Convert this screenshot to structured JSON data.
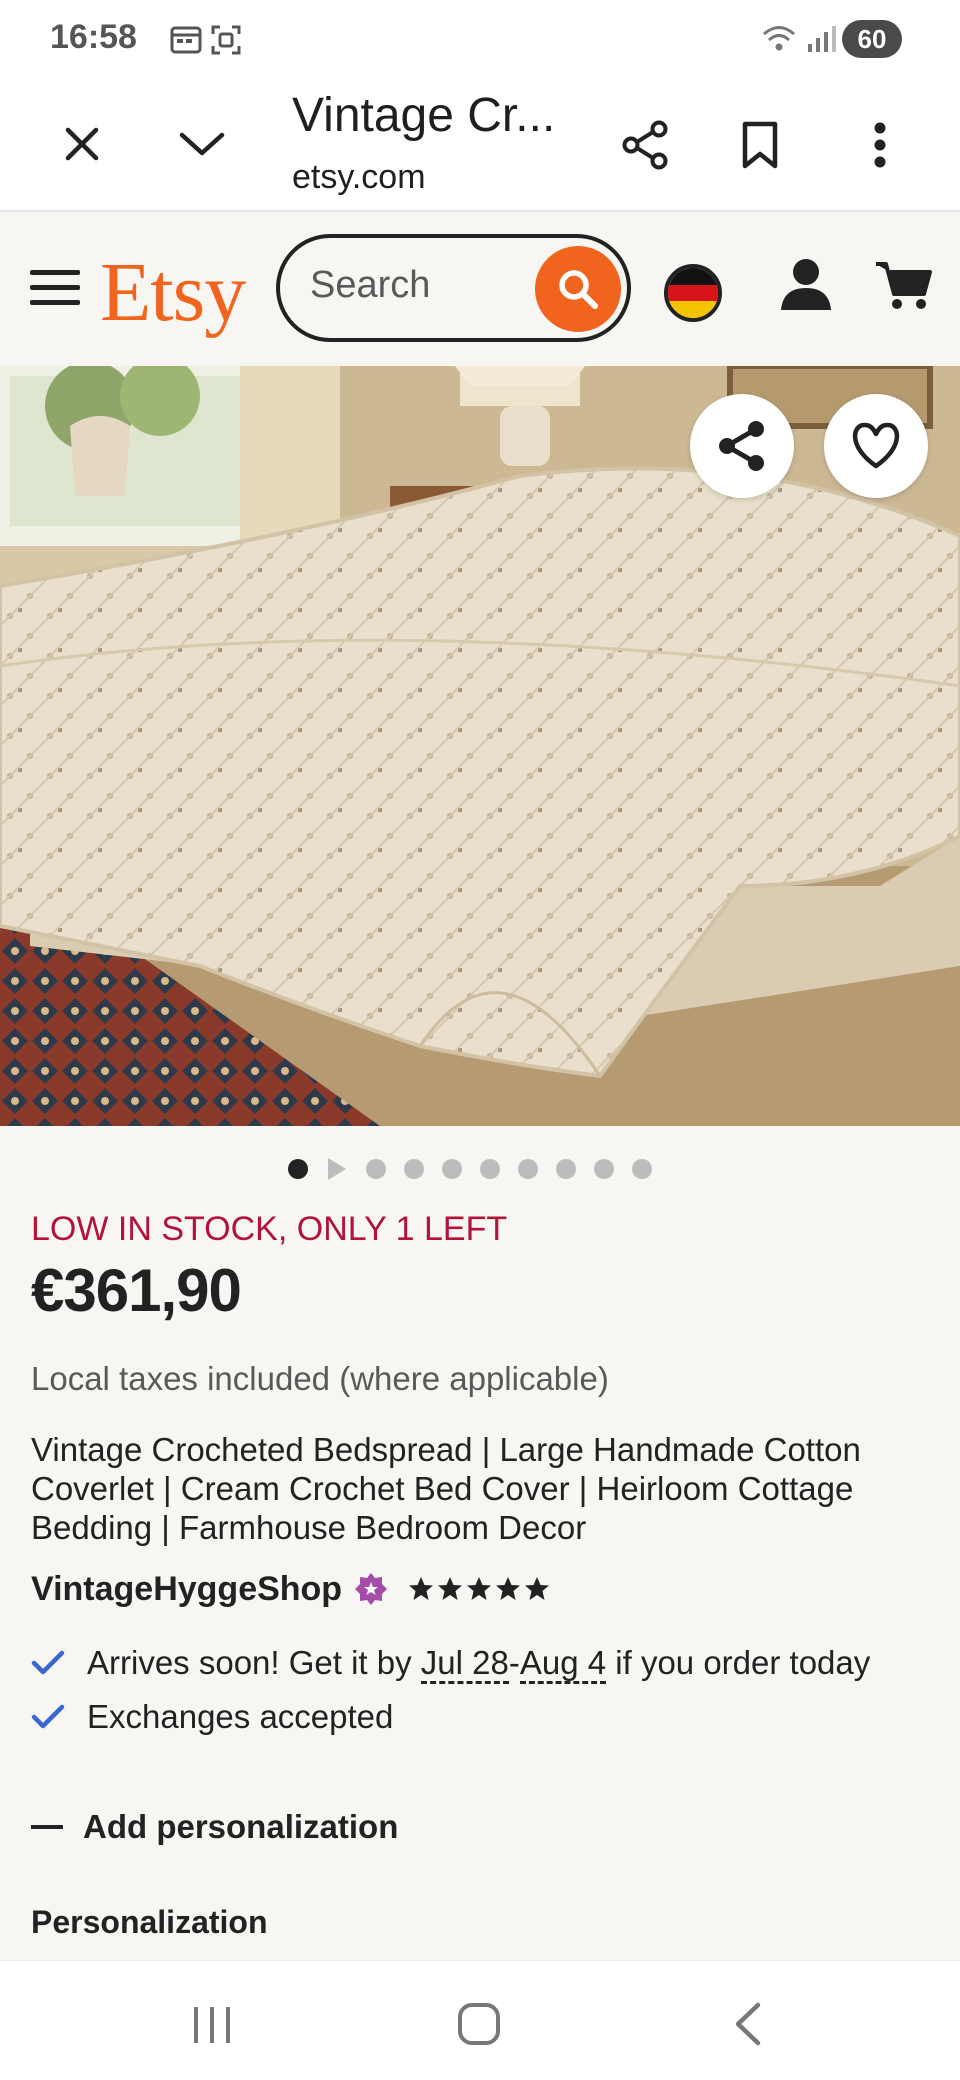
{
  "status_bar": {
    "time": "16:58",
    "battery": "60",
    "icons": [
      "calendar-icon",
      "screenshot-icon",
      "wifi-icon",
      "signal-icon",
      "battery-icon"
    ]
  },
  "browser": {
    "tab_title": "Vintage Cr...",
    "url": "etsy.com",
    "icons": [
      "close-icon",
      "chevron-down-icon",
      "share-icon",
      "bookmark-icon",
      "more-vert-icon"
    ]
  },
  "header": {
    "logo": "Etsy",
    "search_placeholder": "Search",
    "region_flag": "de",
    "colors": {
      "brand": "#f1641e",
      "ink": "#222222"
    }
  },
  "gallery": {
    "image_alt": "Vintage crocheted cream bedspread on a bed",
    "total_items": 10,
    "active_index": 0,
    "second_item_is_video": true
  },
  "product": {
    "stock_notice": "LOW IN STOCK, ONLY 1 LEFT",
    "price": "€361,90",
    "taxes_note": "Local taxes included (where applicable)",
    "title": "Vintage Crocheted Bedspread | Large Handmade Cotton Coverlet | Cream Crochet Bed Cover | Heirloom Cottage Bedding | Farmhouse Bedroom Decor",
    "shop_name": "VintageHyggeShop",
    "rating_stars": 5,
    "colors": {
      "stock": "#b3133a",
      "check": "#3a66d1",
      "star_seller": "#a34ca8"
    }
  },
  "delivery": {
    "arrives_prefix": "Arrives soon! Get it by ",
    "arrives_date_1": "Jul 28",
    "arrives_dash": "-",
    "arrives_date_2": "Aug 4",
    "arrives_suffix": " if you order today",
    "exchanges": "Exchanges accepted"
  },
  "personalization": {
    "toggle_label": "Add personalization",
    "heading": "Personalization"
  }
}
